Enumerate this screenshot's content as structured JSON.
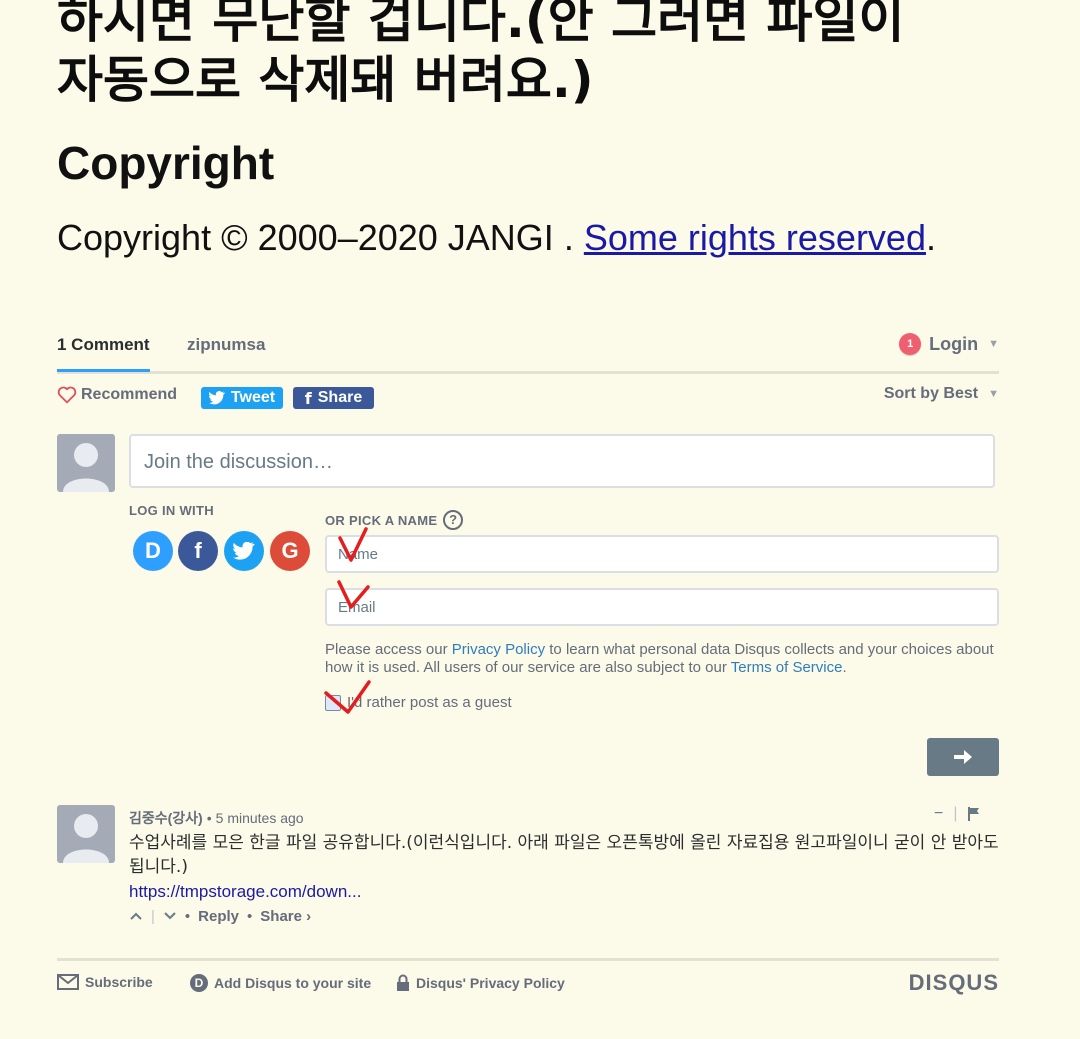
{
  "article": {
    "heading_line1": "하시면 무난할 겁니다.(안 그러면 파일이",
    "heading_line2": "자동으로 삭제돼 버려요.)",
    "copyright_heading": "Copyright",
    "copyright_text": "Copyright © 2000–2020 JANGI . ",
    "copyright_link": "Some rights reserved",
    "copyright_end": "."
  },
  "disqus": {
    "tabs": {
      "comments": "1 Comment",
      "forum": "zipnumsa"
    },
    "login": {
      "badge": "1",
      "label": "Login"
    },
    "toolbar": {
      "recommend": "Recommend",
      "tweet": "Tweet",
      "share": "Share",
      "sort": "Sort by Best"
    },
    "compose": {
      "placeholder": "Join the discussion…"
    },
    "login_with_label": "LOG IN WITH",
    "pick_name_label": "OR PICK A NAME",
    "social": [
      {
        "name": "disqus",
        "glyph": "D",
        "color": "#2e9fff"
      },
      {
        "name": "facebook",
        "glyph": "f",
        "color": "#3b5998"
      },
      {
        "name": "twitter",
        "glyph": "t",
        "color": "#1da1f2"
      },
      {
        "name": "google",
        "glyph": "G",
        "color": "#dd4b39"
      }
    ],
    "name_placeholder": "Name",
    "email_placeholder": "Email",
    "policy": {
      "part1": "Please access our ",
      "privacy_link": "Privacy Policy",
      "part2": " to learn what personal data Disqus collects and your choices about how it is used. All users of our service are also subject to our ",
      "terms_link": "Terms of Service",
      "part3": "."
    },
    "guest_label": "I'd rather post as a guest",
    "guest_checked": true
  },
  "comment": {
    "author": "김중수(강사)",
    "time": "5 minutes ago",
    "body": "수업사례를 모은 한글 파일 공유합니다.(이런식입니다. 아래 파일은 오픈톡방에 올린 자료집용 원고파일이니 굳이 안 받아도 됩니다.)",
    "link": "https://tmpstorage.com/down...",
    "reply": "Reply",
    "share": "Share ›"
  },
  "footer": {
    "subscribe": "Subscribe",
    "add_disqus": "Add Disqus to your site",
    "privacy": "Disqus' Privacy Policy",
    "brand": "DISQUS"
  },
  "colors": {
    "accent_blue": "#2e9fff",
    "annotation_red": "#e41e1e",
    "background": "#fcfae9"
  }
}
